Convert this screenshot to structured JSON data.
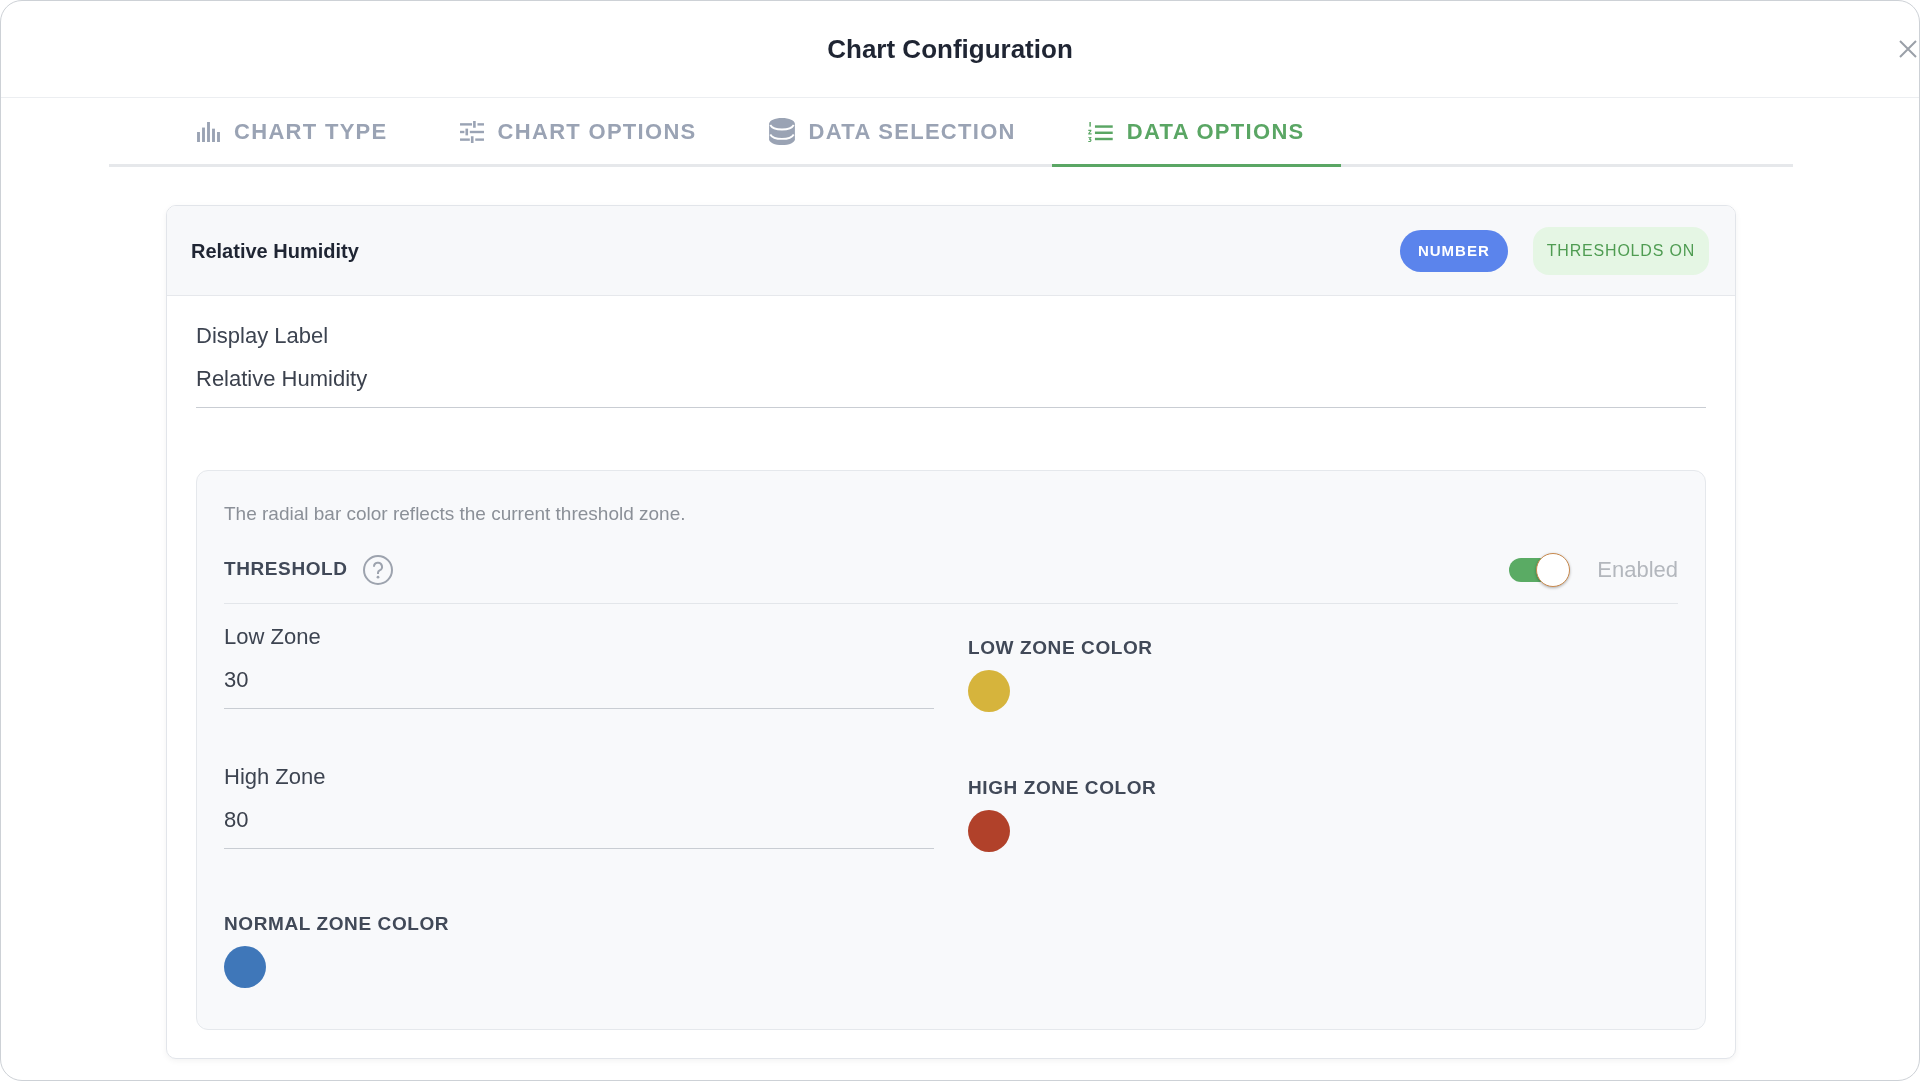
{
  "dialog": {
    "title": "Chart Configuration"
  },
  "tabs": [
    {
      "label": "CHART TYPE",
      "selected": false
    },
    {
      "label": "CHART OPTIONS",
      "selected": false
    },
    {
      "label": "DATA SELECTION",
      "selected": false
    },
    {
      "label": "DATA OPTIONS",
      "selected": true
    }
  ],
  "series_card": {
    "title": "Relative Humidity",
    "badges": [
      {
        "label": "NUMBER",
        "kind": "type"
      },
      {
        "label": "THRESHOLDS ON",
        "kind": "status"
      }
    ],
    "display_label": {
      "label": "Display Label",
      "value": "Relative Humidity"
    },
    "threshold": {
      "hint": "The radial bar color reflects the current threshold zone.",
      "title": "THRESHOLD",
      "enabled": true,
      "toggle_label": "Enabled",
      "zones": [
        {
          "label": "Low Zone",
          "value": "30",
          "color_label": "LOW ZONE COLOR",
          "color": "#d6b43c"
        },
        {
          "label": "High Zone",
          "value": "80",
          "color_label": "HIGH ZONE COLOR",
          "color": "#b1412a"
        }
      ],
      "normal_zone": {
        "color_label": "NORMAL ZONE COLOR",
        "color": "#3f77b9"
      }
    }
  }
}
